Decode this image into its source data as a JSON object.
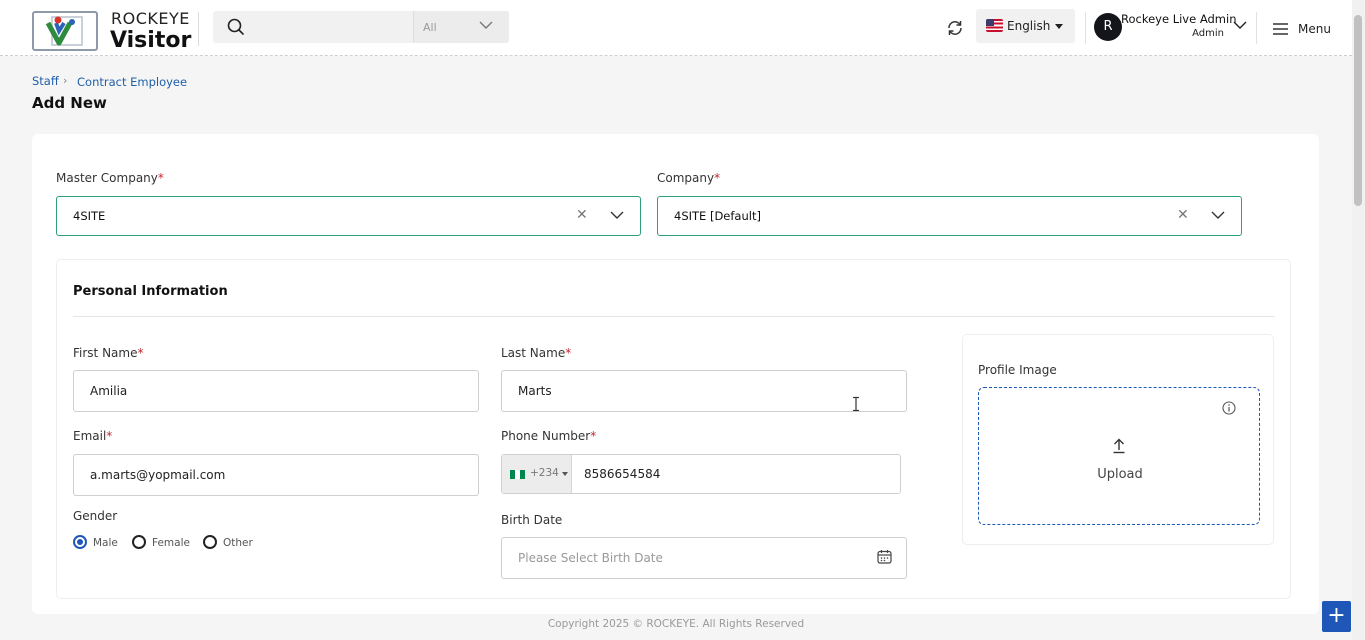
{
  "header": {
    "logo_line1": "ROCKEYE",
    "logo_line2": "Visitor",
    "search": {
      "placeholder": "",
      "filter_value": "All"
    },
    "language": "English",
    "user": {
      "initial": "R",
      "name": "Rockeye Live Admin",
      "role": "Admin"
    },
    "menu_label": "Menu"
  },
  "breadcrumb": {
    "items": [
      "Staff",
      "Contract Employee"
    ]
  },
  "page_title": "Add New",
  "form": {
    "master_company": {
      "label": "Master Company",
      "value": "4SITE"
    },
    "company": {
      "label": "Company",
      "value": "4SITE [Default]"
    },
    "section_title": "Personal Information",
    "first_name": {
      "label": "First Name",
      "value": "Amilia"
    },
    "last_name": {
      "label": "Last Name",
      "value": "Marts"
    },
    "email": {
      "label": "Email",
      "value": "a.marts@yopmail.com"
    },
    "phone": {
      "label": "Phone Number",
      "code": "+234",
      "value": "8586654584"
    },
    "gender": {
      "label": "Gender",
      "options": [
        "Male",
        "Female",
        "Other"
      ],
      "selected": "Male"
    },
    "birth_date": {
      "label": "Birth Date",
      "placeholder": "Please Select Birth Date"
    },
    "profile_image": {
      "label": "Profile Image",
      "upload_label": "Upload"
    },
    "required_mark": "*"
  },
  "footer": "Copyright 2025 © ROCKEYE. All Rights Reserved",
  "colors": {
    "accent": "#1e57b8",
    "valid_border": "#2e9e78",
    "required": "#c0262d",
    "link": "#1f5fa9"
  }
}
